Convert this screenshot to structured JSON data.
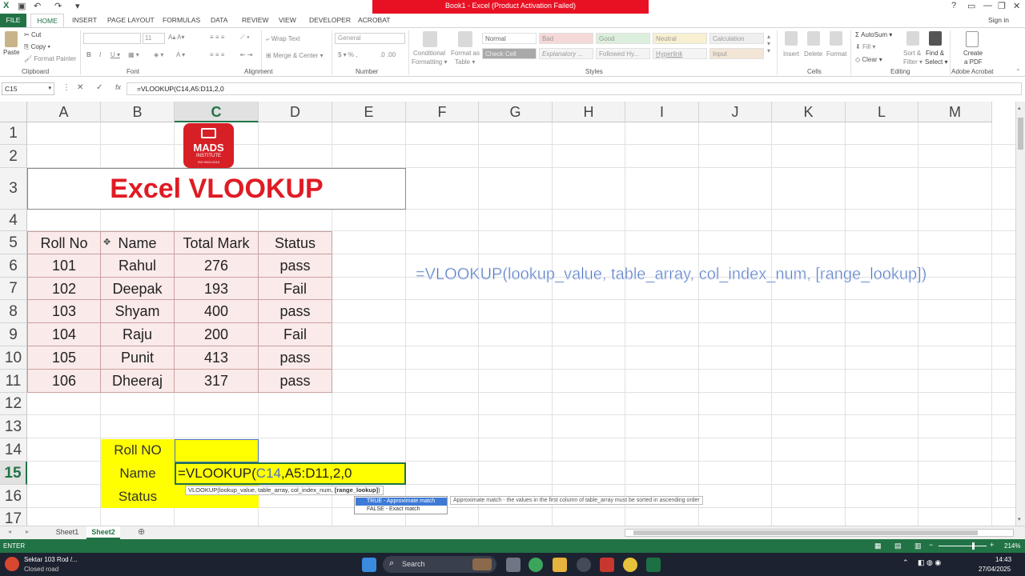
{
  "titlebar": {
    "title": "Book1 -  Excel (Product Activation Failed)",
    "help": "?",
    "minimize": "—",
    "restore": "❐",
    "close": "✕",
    "signin": "Sign in"
  },
  "tabs": [
    "FILE",
    "HOME",
    "INSERT",
    "PAGE LAYOUT",
    "FORMULAS",
    "DATA",
    "REVIEW",
    "VIEW",
    "DEVELOPER",
    "ACROBAT"
  ],
  "ribbon": {
    "paste": "Paste",
    "cut": "Cut",
    "copy": "Copy",
    "format_painter": "Format Painter",
    "font_size": "11",
    "wrap_text": "Wrap Text",
    "merge_center": "Merge & Center",
    "number_format": "General",
    "conditional_formatting_1": "Conditional",
    "conditional_formatting_2": "Formatting",
    "format_as_table_1": "Format as",
    "format_as_table_2": "Table",
    "styles": [
      "Normal",
      "Bad",
      "Good",
      "Neutral",
      "Calculation",
      "Check Cell",
      "Explanatory ...",
      "Followed Hy...",
      "Hyperlink",
      "Input"
    ],
    "insert": "Insert",
    "delete": "Delete",
    "format": "Format",
    "autosum": "AutoSum",
    "fill": "Fill",
    "clear": "Clear",
    "sort_filter_1": "Sort &",
    "sort_filter_2": "Filter",
    "find_select_1": "Find &",
    "find_select_2": "Select",
    "create_pdf_1": "Create",
    "create_pdf_2": "a PDF",
    "groups": [
      "Clipboard",
      "Font",
      "Alignment",
      "Number",
      "Styles",
      "Cells",
      "Editing",
      "Adobe Acrobat"
    ]
  },
  "formula_bar": {
    "name_box": "C15",
    "cancel": "✕",
    "enter": "✓",
    "fx": "fx",
    "formula": "=VLOOKUP(C14,A5:D11,2,0"
  },
  "columns": [
    "A",
    "B",
    "C",
    "D",
    "E",
    "F",
    "G",
    "H",
    "I",
    "J",
    "K",
    "L",
    "M"
  ],
  "rows": [
    "1",
    "2",
    "3",
    "4",
    "5",
    "6",
    "7",
    "8",
    "9",
    "10",
    "11",
    "12",
    "13",
    "14",
    "15",
    "16",
    "17"
  ],
  "logo": {
    "line1": "MADS",
    "line2": "INSTITUTE",
    "line3": "ISO 9001:2015"
  },
  "heading": "Excel VLOOKUP",
  "table": {
    "headers": [
      "Roll No",
      "Name",
      "Total Mark",
      "Status"
    ],
    "rows": [
      [
        "101",
        "Rahul",
        "276",
        "pass"
      ],
      [
        "102",
        "Deepak",
        "193",
        "Fail"
      ],
      [
        "103",
        "Shyam",
        "400",
        "pass"
      ],
      [
        "104",
        "Raju",
        "200",
        "Fail"
      ],
      [
        "105",
        "Punit",
        "413",
        "pass"
      ],
      [
        "106",
        "Dheeraj",
        "317",
        "pass"
      ]
    ]
  },
  "syntax_note": "=VLOOKUP(lookup_value, table_array, col_index_num, [range_lookup])",
  "lookup": {
    "roll_label": "Roll NO",
    "name_label": "Name",
    "status_label": "Status",
    "formula_prefix": "=VLOOKUP(",
    "formula_ref": "C14",
    "formula_rest": ",A5:D11,2,0"
  },
  "tooltip": {
    "syntax_main": "VLOOKUP(lookup_value, table_array, col_index_num, ",
    "syntax_bold": "[range_lookup]",
    "syntax_end": ")",
    "opt_true": "TRUE - Approximate match",
    "opt_false": "FALSE - Exact match",
    "desc": "Approximate match - the values in the first column of table_array must be sorted in ascending order"
  },
  "sheets": [
    "Sheet1",
    "Sheet2"
  ],
  "add_sheet": "⊕",
  "status": {
    "mode": "ENTER",
    "zoom": "214%"
  },
  "taskbar": {
    "weather_line1": "Sektar 103 Rod /...",
    "weather_line2": "Closed road",
    "search": "Search",
    "time": "14:43",
    "date": "27/04/2025"
  },
  "colors": {
    "excel_green": "#217346",
    "title_red": "#e81123",
    "heading_red": "#e01b24",
    "yellow": "#ffff00",
    "syntax_blue": "#4a72c4"
  }
}
